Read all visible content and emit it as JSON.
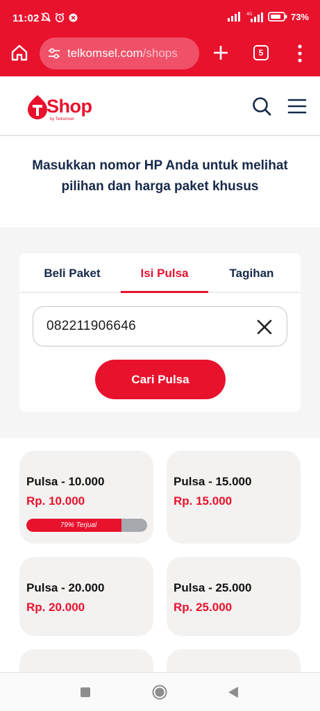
{
  "status_bar": {
    "time": "11:02",
    "battery": "73%",
    "network": "4G"
  },
  "browser": {
    "url_host": "telkomsel.com",
    "url_path": "/shops",
    "tab_count": "5",
    "icons": [
      "home-icon",
      "site-settings-icon",
      "plus-icon",
      "tab-switcher-icon",
      "more-vert-icon"
    ]
  },
  "header": {
    "logo_text": "Shop",
    "logo_sub": "by Telkomsel",
    "icons": [
      "search-icon",
      "hamburger-menu-icon"
    ]
  },
  "headline": "Masukkan nomor HP Anda untuk melihat pilihan dan harga paket khusus",
  "form": {
    "tabs": [
      {
        "label": "Beli Paket",
        "active": false
      },
      {
        "label": "Isi Pulsa",
        "active": true
      },
      {
        "label": "Tagihan",
        "active": false
      }
    ],
    "phone_value": "082211906646",
    "submit_label": "Cari Pulsa"
  },
  "products": [
    {
      "name": "Pulsa - 10.000",
      "price": "Rp. 10.000",
      "sold_label": "79% Terjual",
      "sold_fraction": 0.79
    },
    {
      "name": "Pulsa - 15.000",
      "price": "Rp. 15.000"
    },
    {
      "name": "Pulsa - 20.000",
      "price": "Rp. 20.000"
    },
    {
      "name": "Pulsa - 25.000",
      "price": "Rp. 25.000"
    }
  ],
  "colors": {
    "brand_red": "#e8122d",
    "navy_text": "#16294a",
    "card_bg": "#f3f2f1"
  }
}
